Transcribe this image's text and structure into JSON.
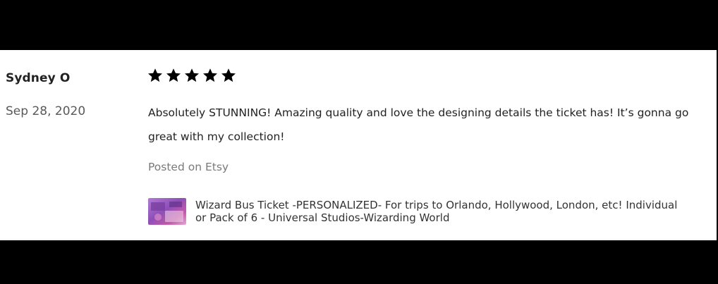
{
  "review": {
    "reviewer_name": "Sydney O",
    "date": "Sep 28, 2020",
    "rating": 5,
    "rating_max": 5,
    "text": "Absolutely STUNNING! Amazing quality and love the designing details the ticket has! It’s gonna go great with my collection!",
    "posted_on": "Posted on Etsy"
  },
  "product": {
    "title": "Wizard Bus Ticket -PERSONALIZED- For trips to Orlando, Hollywood, London, etc! Individual or Pack of 6 - Universal Studios-Wizarding World",
    "thumbnail_icon": "product-thumbnail"
  },
  "colors": {
    "background": "#000000",
    "card": "#ffffff",
    "star": "#000000",
    "text": "#222222",
    "muted": "#7a7a7a"
  }
}
